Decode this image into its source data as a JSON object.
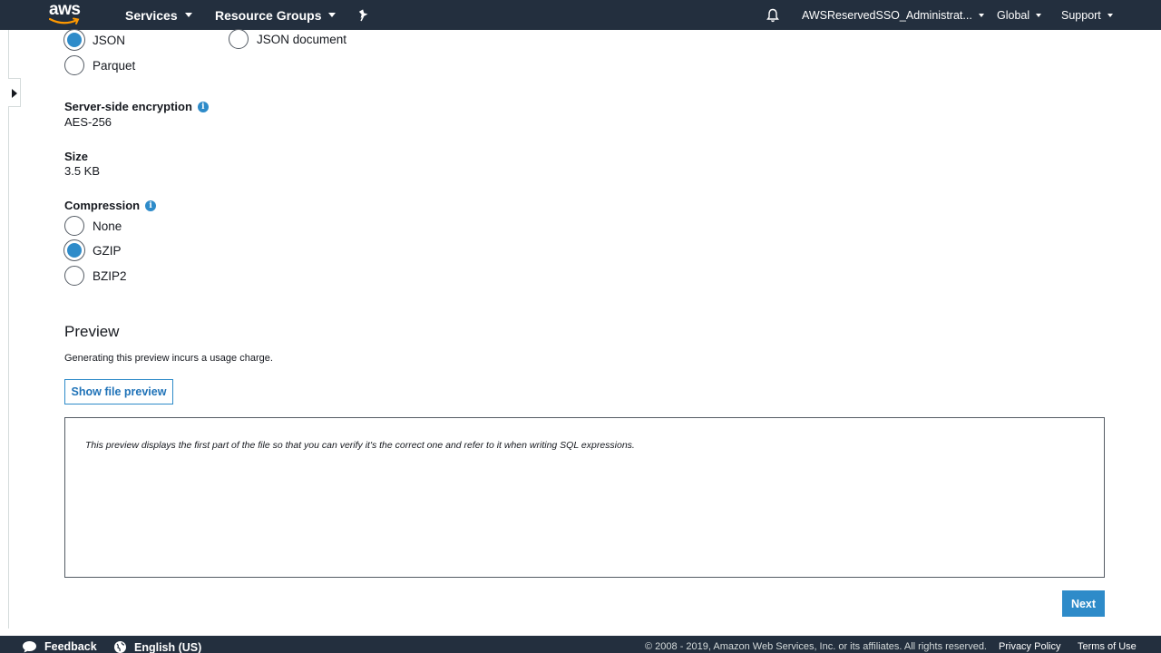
{
  "topnav": {
    "logo_text": "aws",
    "services_label": "Services",
    "resource_groups_label": "Resource Groups",
    "account_label": "AWSReservedSSO_Administrat...",
    "region_label": "Global",
    "support_label": "Support"
  },
  "format": {
    "options": [
      {
        "label": "JSON",
        "checked": true
      },
      {
        "label": "Parquet",
        "checked": false
      },
      {
        "label": "JSON document",
        "checked": false
      }
    ]
  },
  "encryption": {
    "label": "Server-side encryption",
    "value": "AES-256"
  },
  "size": {
    "label": "Size",
    "value": "3.5 KB"
  },
  "compression": {
    "label": "Compression",
    "options": [
      {
        "label": "None",
        "checked": false
      },
      {
        "label": "GZIP",
        "checked": true
      },
      {
        "label": "BZIP2",
        "checked": false
      }
    ]
  },
  "preview": {
    "title": "Preview",
    "description": "Generating this preview incurs a usage charge.",
    "button_label": "Show file preview",
    "box_text": "This preview displays the first part of the file so that you can verify it's the correct one and refer to it when writing SQL expressions."
  },
  "actions": {
    "next_label": "Next"
  },
  "footer": {
    "feedback_label": "Feedback",
    "language_label": "English (US)",
    "copyright": "© 2008 - 2019, Amazon Web Services, Inc. or its affiliates. All rights reserved.",
    "privacy_label": "Privacy Policy",
    "terms_label": "Terms of Use"
  },
  "colors": {
    "nav_bg": "#232f3e",
    "accent": "#2e8bc9",
    "logo_smile": "#ff9900"
  }
}
